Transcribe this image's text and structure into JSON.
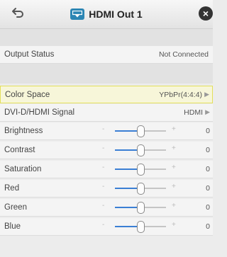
{
  "header": {
    "title": "HDMI Out 1",
    "back_icon": "back-arrow-icon",
    "device_icon": "hdmi-output-icon",
    "close_icon": "close-icon",
    "accent": "#2c86b4"
  },
  "status": {
    "label": "Output Status",
    "value": "Not Connected"
  },
  "settings": {
    "color_space": {
      "label": "Color Space",
      "value": "YPbPr(4:4:4)"
    },
    "signal": {
      "label": "DVI-D/HDMI Signal",
      "value": "HDMI"
    }
  },
  "sliders": [
    {
      "label": "Brightness",
      "value": "0",
      "level": 0.5
    },
    {
      "label": "Contrast",
      "value": "0",
      "level": 0.5
    },
    {
      "label": "Saturation",
      "value": "0",
      "level": 0.5
    },
    {
      "label": "Red",
      "value": "0",
      "level": 0.5
    },
    {
      "label": "Green",
      "value": "0",
      "level": 0.5
    },
    {
      "label": "Blue",
      "value": "0",
      "level": 0.5
    }
  ],
  "selection_color": "#e3df5a"
}
